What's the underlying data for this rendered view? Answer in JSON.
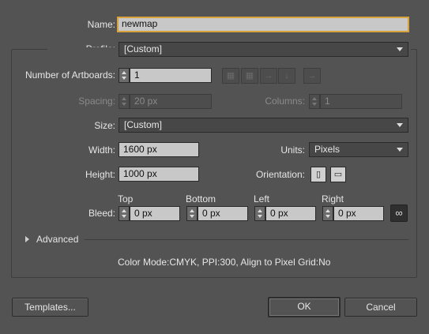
{
  "name": {
    "label": "Name:",
    "value": "newmap"
  },
  "profile": {
    "label": "Profile:",
    "value": "[Custom]"
  },
  "artboards": {
    "label": "Number of Artboards:",
    "value": "1",
    "arrange_icons": [
      "grid-by-row-icon",
      "grid-by-column-icon",
      "arrange-by-row-icon",
      "arrange-by-column-icon",
      "right-to-left-icon"
    ]
  },
  "spacing": {
    "label": "Spacing:",
    "value": "20 px"
  },
  "columns": {
    "label": "Columns:",
    "value": "1"
  },
  "size": {
    "label": "Size:",
    "value": "[Custom]"
  },
  "width": {
    "label": "Width:",
    "value": "1600 px"
  },
  "units": {
    "label": "Units:",
    "value": "Pixels"
  },
  "height": {
    "label": "Height:",
    "value": "1000 px"
  },
  "orientation": {
    "label": "Orientation:",
    "icons": [
      "portrait-icon",
      "landscape-icon"
    ]
  },
  "bleed": {
    "label": "Bleed:",
    "top": {
      "label": "Top",
      "value": "0 px"
    },
    "bottom": {
      "label": "Bottom",
      "value": "0 px"
    },
    "left": {
      "label": "Left",
      "value": "0 px"
    },
    "right": {
      "label": "Right",
      "value": "0 px"
    },
    "link_icon": "link-chain-icon"
  },
  "advanced": {
    "label": "Advanced"
  },
  "summary": "Color Mode:CMYK, PPI:300, Align to Pixel Grid:No",
  "buttons": {
    "templates": "Templates...",
    "ok": "OK",
    "cancel": "Cancel"
  },
  "colors": {
    "background": "#535353",
    "field": "#c8c8c8",
    "focus": "#d9a23c",
    "text": "#e6e6e6"
  }
}
